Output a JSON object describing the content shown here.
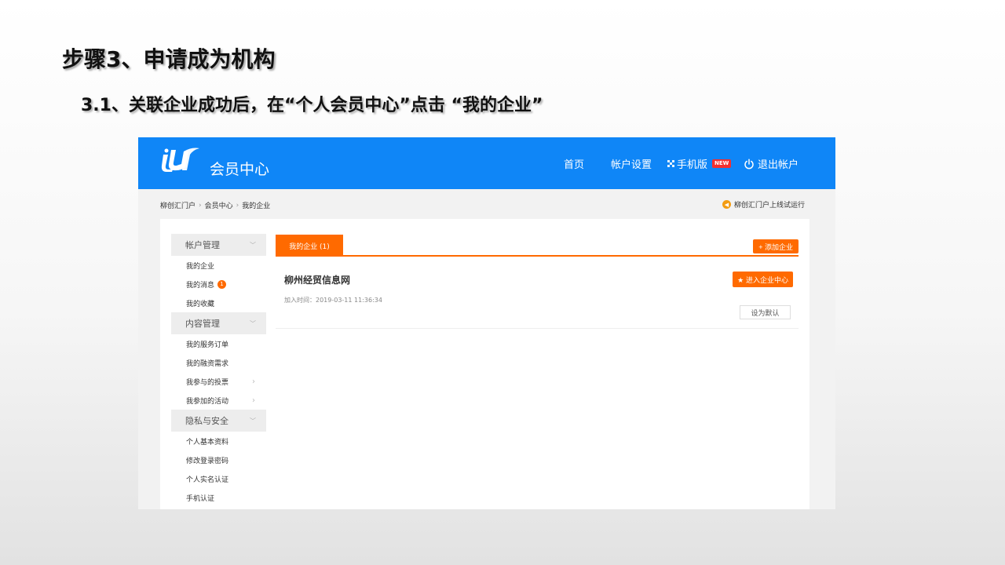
{
  "slide": {
    "title": "步骤3、申请成为机构",
    "subtitle": "3.1、关联企业成功后，在“个人会员中心”点击 “我的企业”"
  },
  "header": {
    "app_name": "会员中心",
    "nav": {
      "home": "首页",
      "account_settings": "帐户设置",
      "mobile": "手机版",
      "new_badge": "NEW",
      "logout": "退出帐户"
    },
    "brand_color": "#0f86f7"
  },
  "breadcrumb": {
    "items": [
      "柳创汇门户",
      "会员中心",
      "我的企业"
    ],
    "separator": "›"
  },
  "notice": "柳创汇门户上线试运行",
  "sidebar": {
    "groups": [
      {
        "title": "帐户管理",
        "items": [
          {
            "label": "我的企业"
          },
          {
            "label": "我的消息",
            "badge": "1"
          },
          {
            "label": "我的收藏"
          }
        ]
      },
      {
        "title": "内容管理",
        "items": [
          {
            "label": "我的服务订单"
          },
          {
            "label": "我的融资需求"
          },
          {
            "label": "我参与的投票"
          },
          {
            "label": "我参加的活动"
          }
        ]
      },
      {
        "title": "隐私与安全",
        "items": [
          {
            "label": "个人基本资料"
          },
          {
            "label": "修改登录密码"
          },
          {
            "label": "个人实名认证"
          },
          {
            "label": "手机认证"
          }
        ]
      }
    ]
  },
  "content": {
    "tab_label": "我的企业 (1)",
    "add_button": "+ 添加企业",
    "company": {
      "name": "柳州经贸信息网",
      "join_time": "加入时间：2019-03-11 11:36:34",
      "enter_button": "★ 进入企业中心",
      "set_default_button": "设为默认"
    },
    "accent_color": "#ff6a00"
  }
}
